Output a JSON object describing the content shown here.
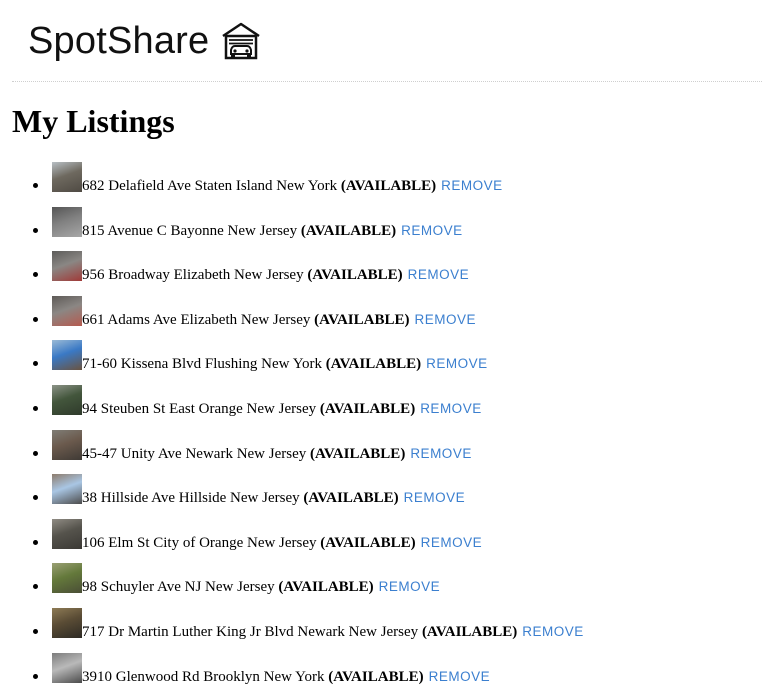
{
  "header": {
    "brand": "SpotShare",
    "icon": "garage-icon"
  },
  "page": {
    "title": "My Listings"
  },
  "listings": [
    {
      "address": "682 Delafield Ave Staten Island New York",
      "status": "(AVAILABLE)",
      "action": "REMOVE",
      "thumb_colors": [
        "#6e695f",
        "#b8bfc4",
        "#4f4a43"
      ]
    },
    {
      "address": "815 Avenue C Bayonne New Jersey",
      "status": "(AVAILABLE)",
      "action": "REMOVE",
      "thumb_colors": [
        "#808080",
        "#555555",
        "#a7a7a7"
      ]
    },
    {
      "address": "956 Broadway Elizabeth New Jersey",
      "status": "(AVAILABLE)",
      "action": "REMOVE",
      "thumb_colors": [
        "#8a8784",
        "#5d5c5a",
        "#a03a38"
      ]
    },
    {
      "address": "661 Adams Ave Elizabeth New Jersey",
      "status": "(AVAILABLE)",
      "action": "REMOVE",
      "thumb_colors": [
        "#8b8784",
        "#5e5a57",
        "#b55a4f"
      ]
    },
    {
      "address": "71-60 Kissena Blvd Flushing New York",
      "status": "(AVAILABLE)",
      "action": "REMOVE",
      "thumb_colors": [
        "#3a79c5",
        "#9bbbd6",
        "#6a5340"
      ]
    },
    {
      "address": "94 Steuben St East Orange New Jersey",
      "status": "(AVAILABLE)",
      "action": "REMOVE",
      "thumb_colors": [
        "#43563c",
        "#8c9387",
        "#2f3a2b"
      ]
    },
    {
      "address": "45-47 Unity Ave Newark New Jersey",
      "status": "(AVAILABLE)",
      "action": "REMOVE",
      "thumb_colors": [
        "#6b5a4d",
        "#7f7d76",
        "#3f3a35"
      ]
    },
    {
      "address": "38 Hillside Ave Hillside New Jersey",
      "status": "(AVAILABLE)",
      "action": "REMOVE",
      "thumb_colors": [
        "#a9c6e4",
        "#8d7c6c",
        "#4c4b4b"
      ]
    },
    {
      "address": "106 Elm St City of Orange New Jersey",
      "status": "(AVAILABLE)",
      "action": "REMOVE",
      "thumb_colors": [
        "#55534c",
        "#908c84",
        "#3b3935"
      ]
    },
    {
      "address": "98 Schuyler Ave NJ New Jersey",
      "status": "(AVAILABLE)",
      "action": "REMOVE",
      "thumb_colors": [
        "#64793b",
        "#9aa074",
        "#4a4e36"
      ]
    },
    {
      "address": "717 Dr Martin Luther King Jr Blvd Newark New Jersey",
      "status": "(AVAILABLE)",
      "action": "REMOVE",
      "thumb_colors": [
        "#5a4c35",
        "#8e7b55",
        "#2d2a24"
      ]
    },
    {
      "address": "3910 Glenwood Rd Brooklyn New York",
      "status": "(AVAILABLE)",
      "action": "REMOVE",
      "thumb_colors": [
        "#b9b9b9",
        "#7c7c7c",
        "#4a4a4a"
      ]
    }
  ],
  "colors": {
    "link": "#3b7fcf",
    "divider": "#cfcfcf",
    "text": "#000000"
  }
}
